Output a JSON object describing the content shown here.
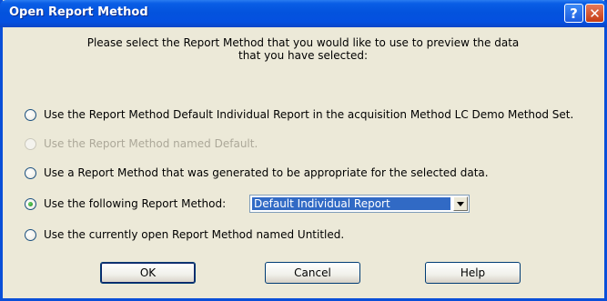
{
  "window": {
    "title": "Open Report Method"
  },
  "titlebar_buttons": {
    "help_glyph": "?",
    "close_glyph": "✕"
  },
  "prompt": {
    "line1": "Please select the Report Method that you would like to use to preview the data",
    "line2": "that you have selected:"
  },
  "options": [
    {
      "label": "Use the Report Method Default Individual Report in the acquisition Method LC Demo Method Set.",
      "checked": false,
      "disabled": false
    },
    {
      "label": "Use the Report Method named Default.",
      "checked": false,
      "disabled": true
    },
    {
      "label": "Use a Report Method that was generated to be appropriate for the selected data.",
      "checked": false,
      "disabled": false
    },
    {
      "label": "Use the following Report Method:",
      "checked": true,
      "disabled": false
    },
    {
      "label": "Use the currently open Report Method named Untitled.",
      "checked": false,
      "disabled": false
    }
  ],
  "report_method_select": {
    "value": "Default Individual Report"
  },
  "buttons": {
    "ok": "OK",
    "cancel": "Cancel",
    "help": "Help"
  },
  "colors": {
    "titlebar": "#0353dd",
    "face": "#ece9d8",
    "selection": "#316ac5"
  }
}
